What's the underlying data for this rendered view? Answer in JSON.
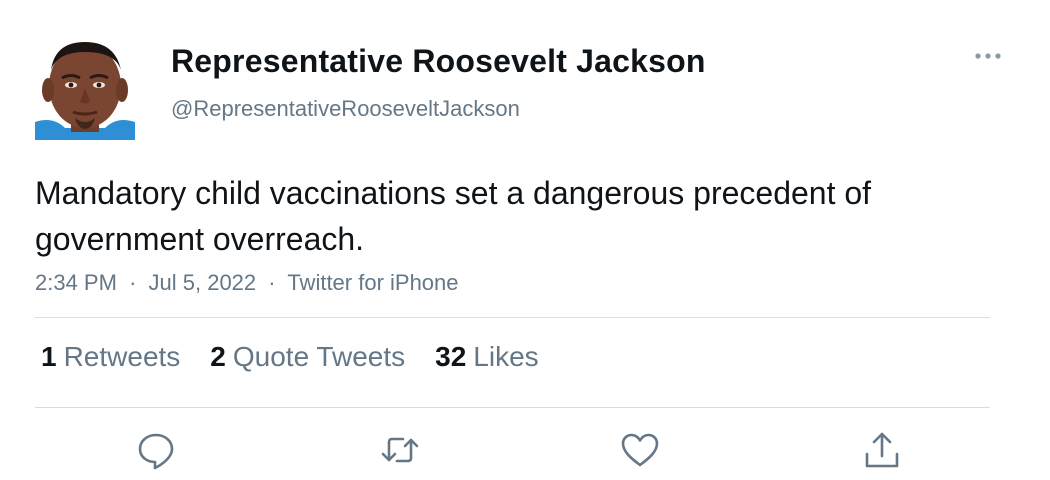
{
  "author": {
    "display_name": "Representative Roosevelt Jackson",
    "handle": "@RepresentativeRooseveltJackson",
    "avatar_icon": "profile-photo"
  },
  "tweet": {
    "text": "Mandatory child vaccinations set a dangerous precedent of government overreach.",
    "time": "2:34 PM",
    "date": "Jul 5, 2022",
    "source": "Twitter for iPhone",
    "separator": "·"
  },
  "stats": {
    "retweets_count": "1",
    "retweets_label": "Retweets",
    "quotes_count": "2",
    "quotes_label": "Quote Tweets",
    "likes_count": "32",
    "likes_label": "Likes"
  },
  "actions": {
    "reply_icon": "speech-bubble-icon",
    "retweet_icon": "retweet-icon",
    "like_icon": "heart-icon",
    "share_icon": "share-icon"
  },
  "colors": {
    "text_primary": "#0f1419",
    "text_secondary": "#657786",
    "divider": "#d8dde1"
  }
}
